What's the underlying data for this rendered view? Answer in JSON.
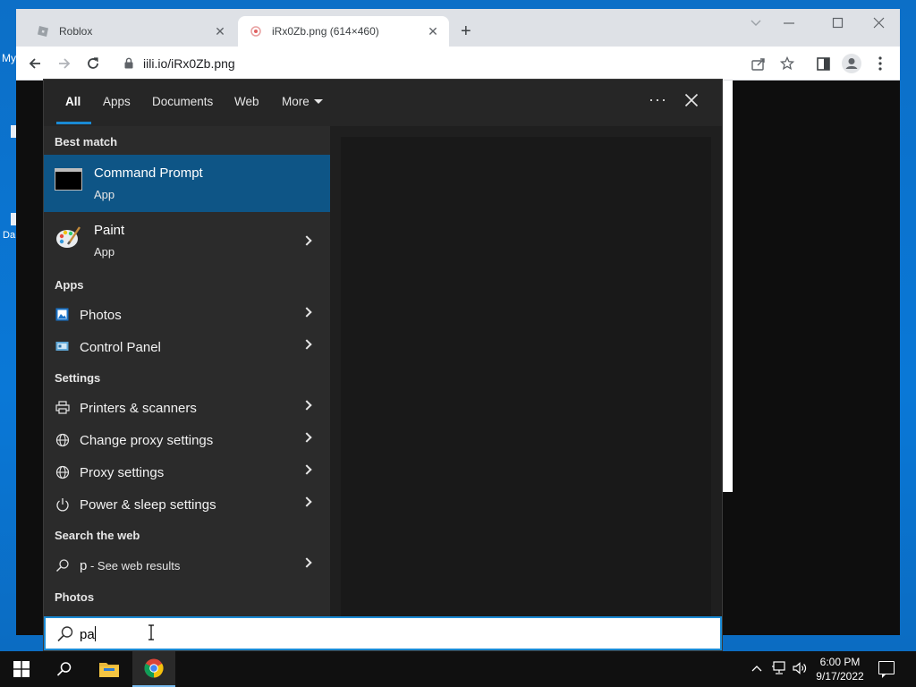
{
  "desktop": {
    "fragments": [
      "My",
      "Da"
    ]
  },
  "browser": {
    "tabs": [
      {
        "title": "Roblox",
        "active": false
      },
      {
        "title": "iRx0Zb.png (614×460)",
        "active": true
      }
    ],
    "url": "iili.io/iRx0Zb.png"
  },
  "search_panel": {
    "filters": [
      "All",
      "Apps",
      "Documents",
      "Web",
      "More"
    ],
    "active_filter": "All",
    "sections": {
      "best_match": "Best match",
      "apps": "Apps",
      "settings": "Settings",
      "search_web": "Search the web",
      "photos": "Photos"
    },
    "best_match": {
      "title": "Command Prompt",
      "subtitle": "App"
    },
    "paint": {
      "title": "Paint",
      "subtitle": "App"
    },
    "apps": [
      "Photos",
      "Control Panel"
    ],
    "settings": [
      "Printers & scanners",
      "Change proxy settings",
      "Proxy settings",
      "Power & sleep settings"
    ],
    "web": {
      "query": "p",
      "suffix": " - See web results"
    },
    "query": "pa"
  },
  "taskbar": {
    "time": "6:00 PM",
    "date": "9/17/2022"
  },
  "colors": {
    "accent": "#1a8ad4",
    "selected": "#0e5586",
    "panel": "#2b2b2b"
  }
}
